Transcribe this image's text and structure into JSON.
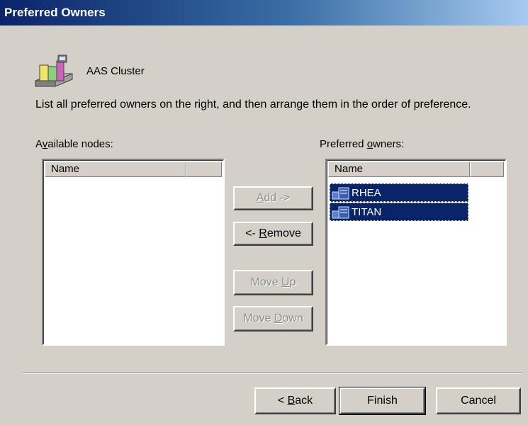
{
  "dialog": {
    "title": "Preferred Owners"
  },
  "resource": {
    "name": "AAS Cluster",
    "icon": "cluster-resource-icon"
  },
  "instructions": "List all preferred owners on the right, and then arrange them in the order of preference.",
  "available": {
    "label_pre": "A",
    "label_ul": "v",
    "label_post": "ailable nodes:",
    "column": "Name",
    "items": []
  },
  "preferred": {
    "label_pre": "Preferred ",
    "label_ul": "o",
    "label_post": "wners:",
    "column": "Name",
    "items": [
      {
        "name": "RHEA",
        "icon": "server-node-icon",
        "selected": true
      },
      {
        "name": "TITAN",
        "icon": "server-node-icon",
        "selected": true
      }
    ]
  },
  "buttons": {
    "add": {
      "pre": "",
      "ul": "A",
      "post": "dd ->",
      "enabled": false
    },
    "remove": {
      "pre": "<- ",
      "ul": "R",
      "post": "emove",
      "enabled": true
    },
    "move_up": {
      "pre": "Move ",
      "ul": "U",
      "post": "p",
      "enabled": false
    },
    "move_down": {
      "pre": "Move ",
      "ul": "D",
      "post": "own",
      "enabled": false
    }
  },
  "footer": {
    "back": {
      "pre": "< ",
      "ul": "B",
      "post": "ack"
    },
    "finish": "Finish",
    "cancel": "Cancel"
  },
  "colors": {
    "title_start": "#0a246a",
    "title_end": "#a6caf0",
    "selection": "#0a246a",
    "face": "#d4d0c8"
  }
}
